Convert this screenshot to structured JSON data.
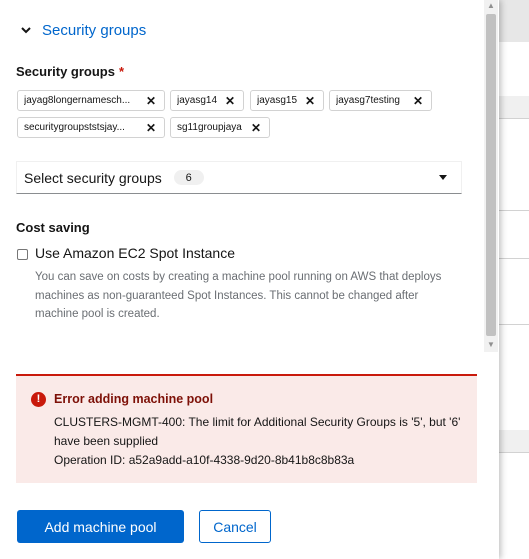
{
  "section": {
    "toggle_label": "Security groups"
  },
  "security_groups": {
    "label": "Security groups",
    "required_marker": "*",
    "chips": [
      "jayag8longernamesch...",
      "jayasg14",
      "jayasg15",
      "jayasg7testing",
      "securitygroupststsjay...",
      "sg11groupjaya"
    ],
    "select_placeholder": "Select security groups",
    "select_count": "6"
  },
  "cost_saving": {
    "label": "Cost saving",
    "checkbox_label": "Use Amazon EC2 Spot Instance",
    "checked": false,
    "helper_text": "You can save on costs by creating a machine pool running on AWS that deploys machines as non-guaranteed Spot Instances. This cannot be changed after machine pool is created."
  },
  "alert": {
    "title": "Error adding machine pool",
    "message": "CLUSTERS-MGMT-400: The limit for Additional Security Groups is '5', but '6' have been supplied",
    "operation_id": "Operation ID: a52a9add-a10f-4338-9d20-8b41b8c8b83a"
  },
  "footer": {
    "primary_label": "Add machine pool",
    "cancel_label": "Cancel"
  },
  "icons": {
    "chevron": "chevron-down-icon",
    "chip_remove": "close-icon",
    "select_toggle": "caret-down-icon",
    "error": "exclamation-circle-icon"
  },
  "colors": {
    "link": "#0066cc",
    "danger": "#c9190b",
    "alert_bg": "#faeae8"
  }
}
